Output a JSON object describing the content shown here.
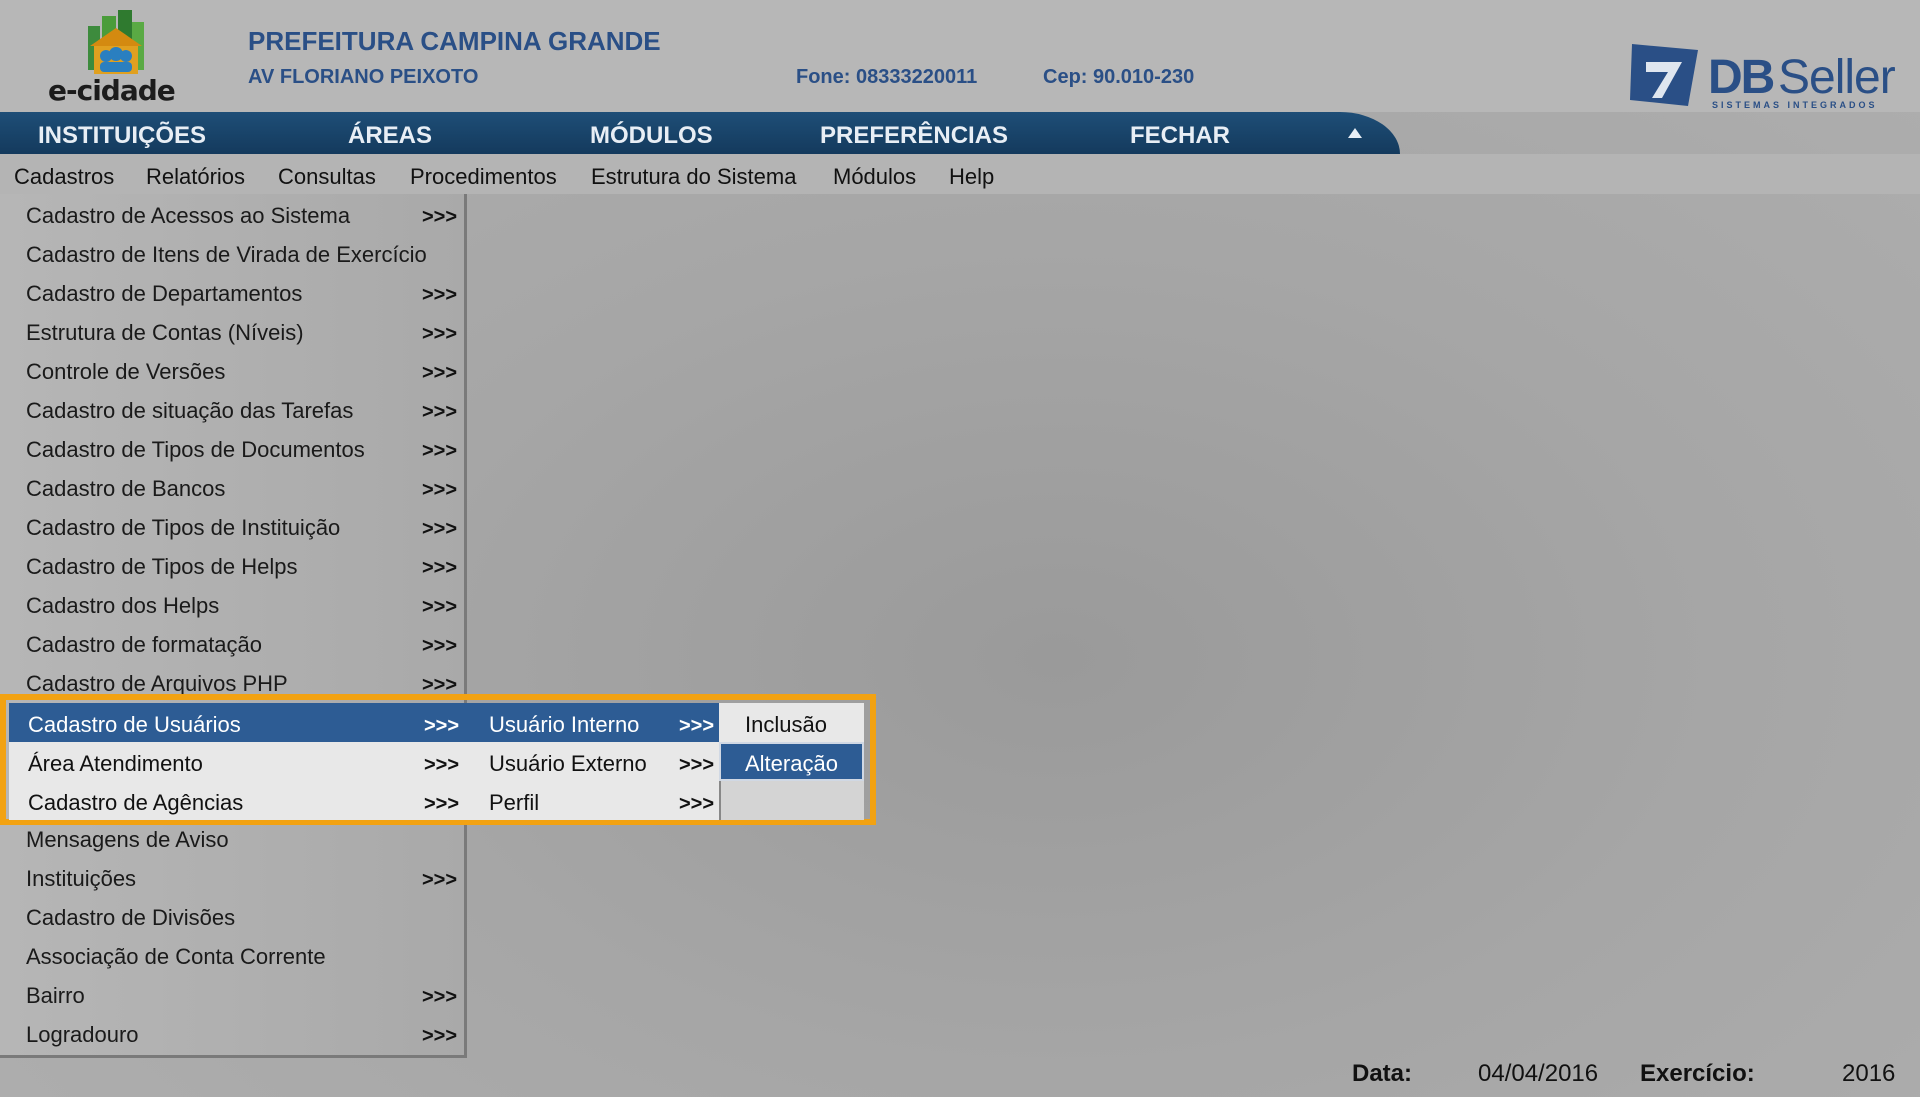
{
  "header": {
    "logo_text": "e-cidade",
    "org_name": "PREFEITURA CAMPINA GRANDE",
    "address": "AV FLORIANO PEIXOTO",
    "phone": "Fone: 08333220011",
    "cep": "Cep: 90.010-230",
    "brand_db": "DB",
    "brand_seller": "Seller",
    "brand_sub": "SISTEMAS INTEGRADOS"
  },
  "top_nav": {
    "items": [
      "INSTITUIÇÕES",
      "ÁREAS",
      "MÓDULOS",
      "PREFERÊNCIAS",
      "FECHAR"
    ]
  },
  "menu_bar": {
    "items": [
      "Cadastros",
      "Relatórios",
      "Consultas",
      "Procedimentos",
      "Estrutura do Sistema",
      "Módulos",
      "Help"
    ]
  },
  "dropdown": {
    "arrow": ">>>",
    "items": [
      "Cadastro de Acessos ao Sistema",
      "Cadastro de Itens de Virada de Exercício",
      "Cadastro de Departamentos",
      "Estrutura de Contas (Níveis)",
      "Controle de Versões",
      "Cadastro de situação das Tarefas",
      "Cadastro de Tipos de Documentos",
      "Cadastro de Bancos",
      "Cadastro de Tipos de Instituição",
      "Cadastro de Tipos de Helps",
      "Cadastro dos Helps",
      "Cadastro de formatação",
      "Cadastro de Arquivos PHP",
      "Cadastro de Usuários",
      "Área Atendimento",
      "Cadastro de Agências",
      "Mensagens de Aviso",
      "Instituições",
      "Cadastro de Divisões",
      "Associação de Conta Corrente",
      "Bairro",
      "Logradouro"
    ]
  },
  "submenu_usuarios": {
    "items": [
      "Usuário Interno",
      "Usuário Externo",
      "Perfil"
    ]
  },
  "submenu_interno": {
    "items": [
      "Inclusão",
      "Alteração"
    ]
  },
  "footer": {
    "date_label": "Data:",
    "date_value": "04/04/2016",
    "year_label": "Exercício:",
    "year_value": "2016"
  },
  "colors": {
    "nav_bg": "#1e4e77",
    "selected": "#2d5c94",
    "highlight_border": "#f2a212",
    "brand_text": "#2a4f86"
  }
}
